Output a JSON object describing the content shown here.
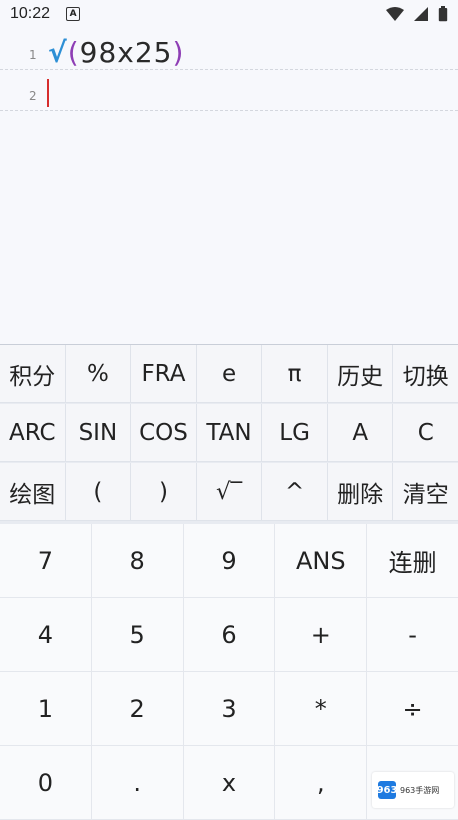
{
  "status_bar": {
    "time": "10:22",
    "a_icon": "A"
  },
  "editor": {
    "lines": [
      {
        "number": "1",
        "sqrt": "√",
        "open_paren": "(",
        "content": "98x25",
        "close_paren": ")"
      },
      {
        "number": "2"
      }
    ]
  },
  "keypad_top": [
    [
      "积分",
      "%",
      "FRA",
      "e",
      "π",
      "历史",
      "切换"
    ],
    [
      "ARC",
      "SIN",
      "COS",
      "TAN",
      "LG",
      "A",
      "C"
    ],
    [
      "绘图",
      "(",
      ")",
      "√‾",
      "^",
      "删除",
      "清空"
    ]
  ],
  "keypad_main": [
    [
      "7",
      "8",
      "9",
      "ANS",
      "连删"
    ],
    [
      "4",
      "5",
      "6",
      "+",
      "-"
    ],
    [
      "1",
      "2",
      "3",
      "*",
      "÷"
    ],
    [
      "0",
      ".",
      "x",
      ","
    ]
  ],
  "watermark": {
    "logo": "963",
    "text": "963手游网"
  },
  "colors": {
    "sqrt": "#2d8fd5",
    "paren": "#8e3eb5",
    "cursor": "#d62d2d"
  }
}
